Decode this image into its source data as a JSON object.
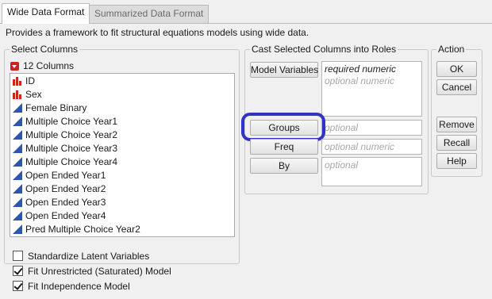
{
  "tabs": [
    {
      "label": "Wide Data Format",
      "active": true
    },
    {
      "label": "Summarized Data Format",
      "active": false
    }
  ],
  "description": "Provides a framework to fit structural equations models using wide data.",
  "select_columns": {
    "title": "Select Columns",
    "count_label": "12 Columns",
    "columns": [
      {
        "name": "ID",
        "icon": "nominal-bar-icon"
      },
      {
        "name": "Sex",
        "icon": "nominal-bar-icon"
      },
      {
        "name": "Female Binary",
        "icon": "continuous-triangle-icon"
      },
      {
        "name": "Multiple Choice Year1",
        "icon": "continuous-triangle-icon"
      },
      {
        "name": "Multiple Choice Year2",
        "icon": "continuous-triangle-icon"
      },
      {
        "name": "Multiple Choice Year3",
        "icon": "continuous-triangle-icon"
      },
      {
        "name": "Multiple Choice Year4",
        "icon": "continuous-triangle-icon"
      },
      {
        "name": "Open Ended Year1",
        "icon": "continuous-triangle-icon"
      },
      {
        "name": "Open Ended Year2",
        "icon": "continuous-triangle-icon"
      },
      {
        "name": "Open Ended Year3",
        "icon": "continuous-triangle-icon"
      },
      {
        "name": "Open Ended Year4",
        "icon": "continuous-triangle-icon"
      },
      {
        "name": "Pred Multiple Choice Year2",
        "icon": "continuous-triangle-icon"
      }
    ]
  },
  "cast_roles": {
    "title": "Cast Selected Columns into Roles",
    "model_variables_button": "Model Variables",
    "model_variables_required": "required numeric",
    "model_variables_optional": "optional numeric",
    "groups_button": "Groups",
    "groups_placeholder": "optional",
    "freq_button": "Freq",
    "freq_placeholder": "optional numeric",
    "by_button": "By",
    "by_placeholder": "optional"
  },
  "action": {
    "title": "Action",
    "ok": "OK",
    "cancel": "Cancel",
    "remove": "Remove",
    "recall": "Recall",
    "help": "Help"
  },
  "options": [
    {
      "label": "Standardize Latent Variables",
      "checked": false
    },
    {
      "label": "Fit Unrestricted (Saturated) Model",
      "checked": true
    },
    {
      "label": "Fit Independence Model",
      "checked": true
    }
  ],
  "colors": {
    "highlight": "#3133c5",
    "nominal_icon": "#c8281e",
    "continuous_icon": "#2f55b0",
    "dropdown_icon": "#d21f1f"
  }
}
